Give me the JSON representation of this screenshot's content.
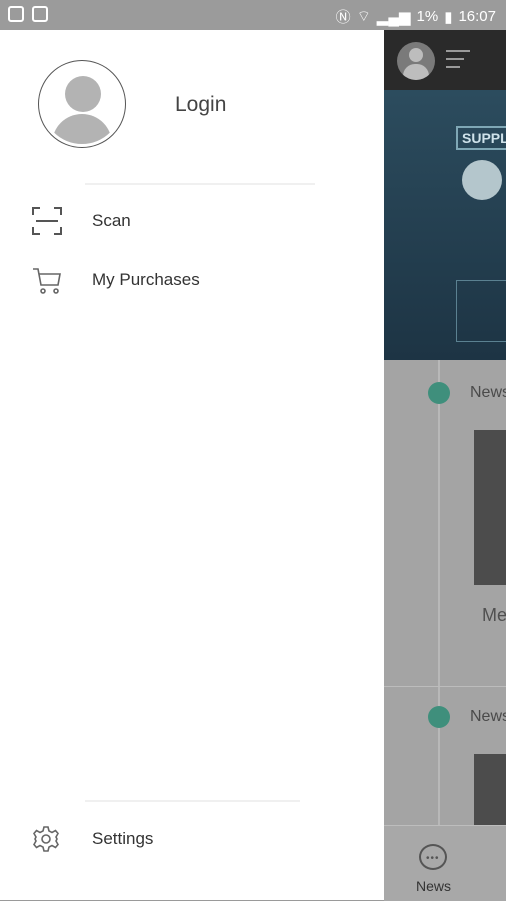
{
  "status_bar": {
    "battery": "1%",
    "time": "16:07"
  },
  "drawer": {
    "login_label": "Login",
    "menu": [
      {
        "label": "Scan",
        "icon": "scan-icon"
      },
      {
        "label": "My Purchases",
        "icon": "cart-icon"
      }
    ],
    "settings_label": "Settings"
  },
  "background_app": {
    "banner_text": "SUPPLY",
    "feed_items": [
      {
        "label": "News",
        "snippet": "Me"
      },
      {
        "label": "News"
      }
    ],
    "bottom_nav": {
      "label": "News"
    }
  },
  "colors": {
    "status_bar": "#9b9b9b",
    "accent_green": "#3f8f7c"
  }
}
